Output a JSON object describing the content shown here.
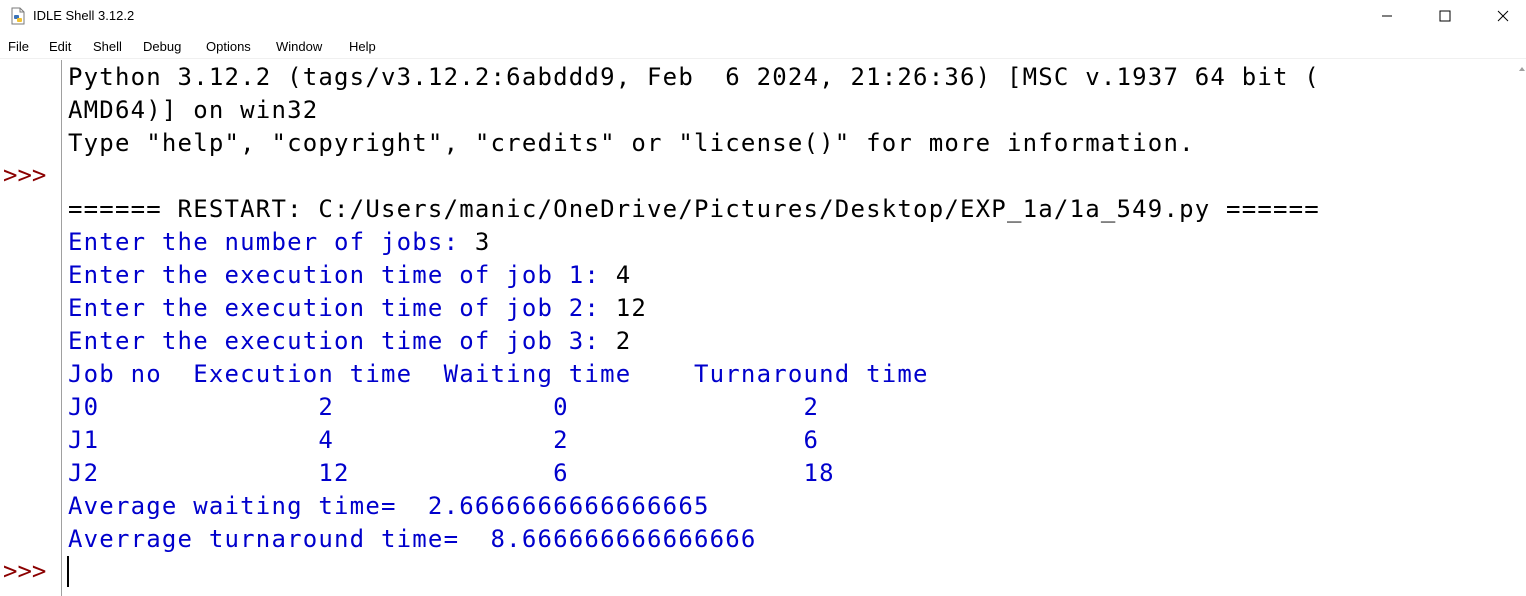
{
  "window": {
    "title": "IDLE Shell 3.12.2",
    "icons": [
      "python-file-icon",
      "minimize-icon",
      "maximize-icon",
      "close-icon"
    ]
  },
  "menu": {
    "items": [
      "File",
      "Edit",
      "Shell",
      "Debug",
      "Options",
      "Window",
      "Help"
    ]
  },
  "prompts": {
    "p1": ">>>",
    "p2": ">>>"
  },
  "shell": {
    "banner1": "Python 3.12.2 (tags/v3.12.2:6abddd9, Feb  6 2024, 21:26:36) [MSC v.1937 64 bit (",
    "banner2": "AMD64)] on win32",
    "banner3": "Type \"help\", \"copyright\", \"credits\" or \"license()\" for more information.",
    "restart": "====== RESTART: C:/Users/manic/OneDrive/Pictures/Desktop/EXP_1a/1a_549.py ======",
    "prompt_jobs": "Enter the number of jobs: ",
    "input_jobs": "3",
    "prompt_job1": "Enter the execution time of job 1: ",
    "input_job1": "4",
    "prompt_job2": "Enter the execution time of job 2: ",
    "input_job2": "12",
    "prompt_job3": "Enter the execution time of job 3: ",
    "input_job3": "2",
    "header": "Job no  Execution time  Waiting time    Turnaround time",
    "row0": "J0              2              0               2",
    "row1": "J1              4              2               6",
    "row2": "J2              12             6               18",
    "avg_wait": "Average waiting time=  2.6666666666666665",
    "avg_turn": "Averrage turnaround time=  8.666666666666666"
  },
  "colors": {
    "output_blue": "#0000cc",
    "prompt_red": "#8b0000",
    "input_black": "#000000"
  }
}
